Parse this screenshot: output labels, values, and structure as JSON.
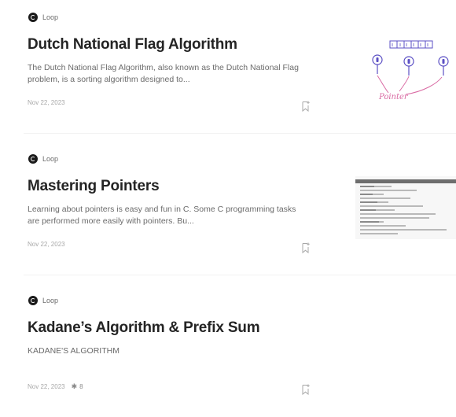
{
  "articles": [
    {
      "publication": "Loop",
      "title": "Dutch National Flag Algorithm",
      "excerpt": "The Dutch National Flag Algorithm, also known as the Dutch National Flag problem, is a sorting algorithm designed to...",
      "date": "Nov 22, 2023",
      "thumbnail_text": "Pointer"
    },
    {
      "publication": "Loop",
      "title": "Mastering Pointers",
      "excerpt": "Learning about pointers is easy and fun in C. Some C programming tasks are performed more easily with pointers. Bu...",
      "date": "Nov 22, 2023"
    },
    {
      "publication": "Loop",
      "title": "Kadane’s Algorithm & Prefix Sum",
      "excerpt": "KADANE'S ALGORITHM",
      "date": "Nov 22, 2023",
      "claps": "8"
    }
  ],
  "icons": {
    "publication_logo": "loop-logo-icon",
    "bookmark": "bookmark-add-icon",
    "clap": "clap-icon"
  },
  "colors": {
    "title": "#242424",
    "secondary_text": "#6b6b6b",
    "meta_text": "#a8a8a8",
    "sketch_blue": "#5b4fc4",
    "sketch_pink": "#d96aa3"
  }
}
